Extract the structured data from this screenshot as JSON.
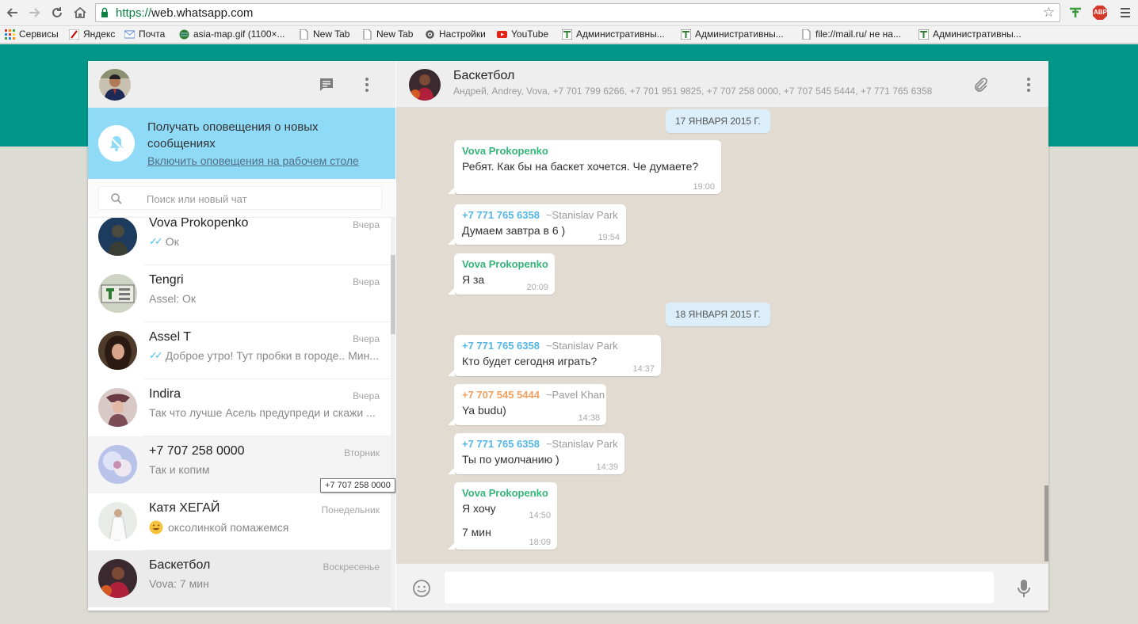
{
  "browser": {
    "url_scheme": "https://",
    "url_rest": "web.whatsapp.com",
    "bookmarks": [
      {
        "label": "Сервисы",
        "icon": "apps-grid-icon"
      },
      {
        "label": "Яндекс",
        "icon": "yandex-icon"
      },
      {
        "label": "Почта",
        "icon": "mail-icon"
      },
      {
        "label": "asia-map.gif (1100×...",
        "icon": "globe-icon"
      },
      {
        "label": "New Tab",
        "icon": "page-icon"
      },
      {
        "label": "New Tab",
        "icon": "page-icon"
      },
      {
        "label": "Настройки",
        "icon": "gear-icon"
      },
      {
        "label": "YouTube",
        "icon": "youtube-icon"
      },
      {
        "label": "Административны...",
        "icon": "site-icon"
      },
      {
        "label": "Административны...",
        "icon": "site-icon"
      },
      {
        "label": "file://mail.ru/ не на...",
        "icon": "page-icon"
      },
      {
        "label": "Административны...",
        "icon": "site-icon"
      }
    ],
    "abp_label": "ABP"
  },
  "sidebar": {
    "notification": {
      "title": "Получать оповещения о новых сообщениях",
      "link": "Включить оповещения на рабочем столе"
    },
    "search_placeholder": "Поиск или новый чат",
    "chats": [
      {
        "name": "Vova Prokopenko",
        "time": "Вчера",
        "preview": "Ок",
        "ticks": true
      },
      {
        "name": "Tengri",
        "time": "Вчера",
        "preview": "Assel: Ок",
        "ticks": false
      },
      {
        "name": "Assel T",
        "time": "Вчера",
        "preview": "Доброе утро! Тут пробки в городе.. Мин...",
        "ticks": true
      },
      {
        "name": "Indira",
        "time": "Вчера",
        "preview": "Так что лучше Асель предупреди и скажи ...",
        "ticks": false
      },
      {
        "name": "+7 707 258 0000",
        "time": "Вторник",
        "preview": "Так и копим",
        "ticks": false
      },
      {
        "name": "Катя ХЕГАЙ",
        "time": "Понедельник",
        "preview": "оксолинкой помажемся",
        "ticks": false
      },
      {
        "name": "Баскетбол",
        "time": "Воскресенье",
        "preview": "Vova: 7 мин",
        "ticks": false
      }
    ],
    "tooltip": "+7 707 258 0000"
  },
  "conversation": {
    "title": "Баскетбол",
    "members": "Андрей, Andrey, Vova, +7 701 799 6266, +7 701 951 9825, +7 707 258 0000, +7 707 545 5444, +7 771 765 6358",
    "dates": [
      "17 ЯНВАРЯ 2015 Г.",
      "18 ЯНВАРЯ 2015 Г."
    ],
    "messages": [
      {
        "sender": "Vova Prokopenko",
        "sender_name": "",
        "text": "Ребят. Как бы на баскет хочется. Че думаете?",
        "time": "19:00"
      },
      {
        "sender": "+7 771 765 6358",
        "sender_name": "~Stanislav Park",
        "text": "Думаем завтра в 6 )",
        "time": "19:54"
      },
      {
        "sender": "Vova Prokopenko",
        "sender_name": "",
        "text": "Я за",
        "time": "20:09"
      },
      {
        "sender": "+7 771 765 6358",
        "sender_name": "~Stanislav Park",
        "text": "Кто будет сегодня играть?",
        "time": "14:37"
      },
      {
        "sender": "+7 707 545 5444",
        "sender_name": "~Pavel Khan",
        "text": "Ya budu)",
        "time": "14:38"
      },
      {
        "sender": "+7 771 765 6358",
        "sender_name": "~Stanislav Park",
        "text": "Ты по умолчанию )",
        "time": "14:39"
      },
      {
        "sender": "Vova Prokopenko",
        "sender_name": "",
        "text": "Я хочу",
        "time": "14:50",
        "text2": "7 мин",
        "time2": "18:09"
      }
    ]
  },
  "colors": {
    "teal": "#009688",
    "notif_bg": "#8fdaf7",
    "chat_bg": "#e2dbd2",
    "tick_blue": "#4fc3f7"
  }
}
